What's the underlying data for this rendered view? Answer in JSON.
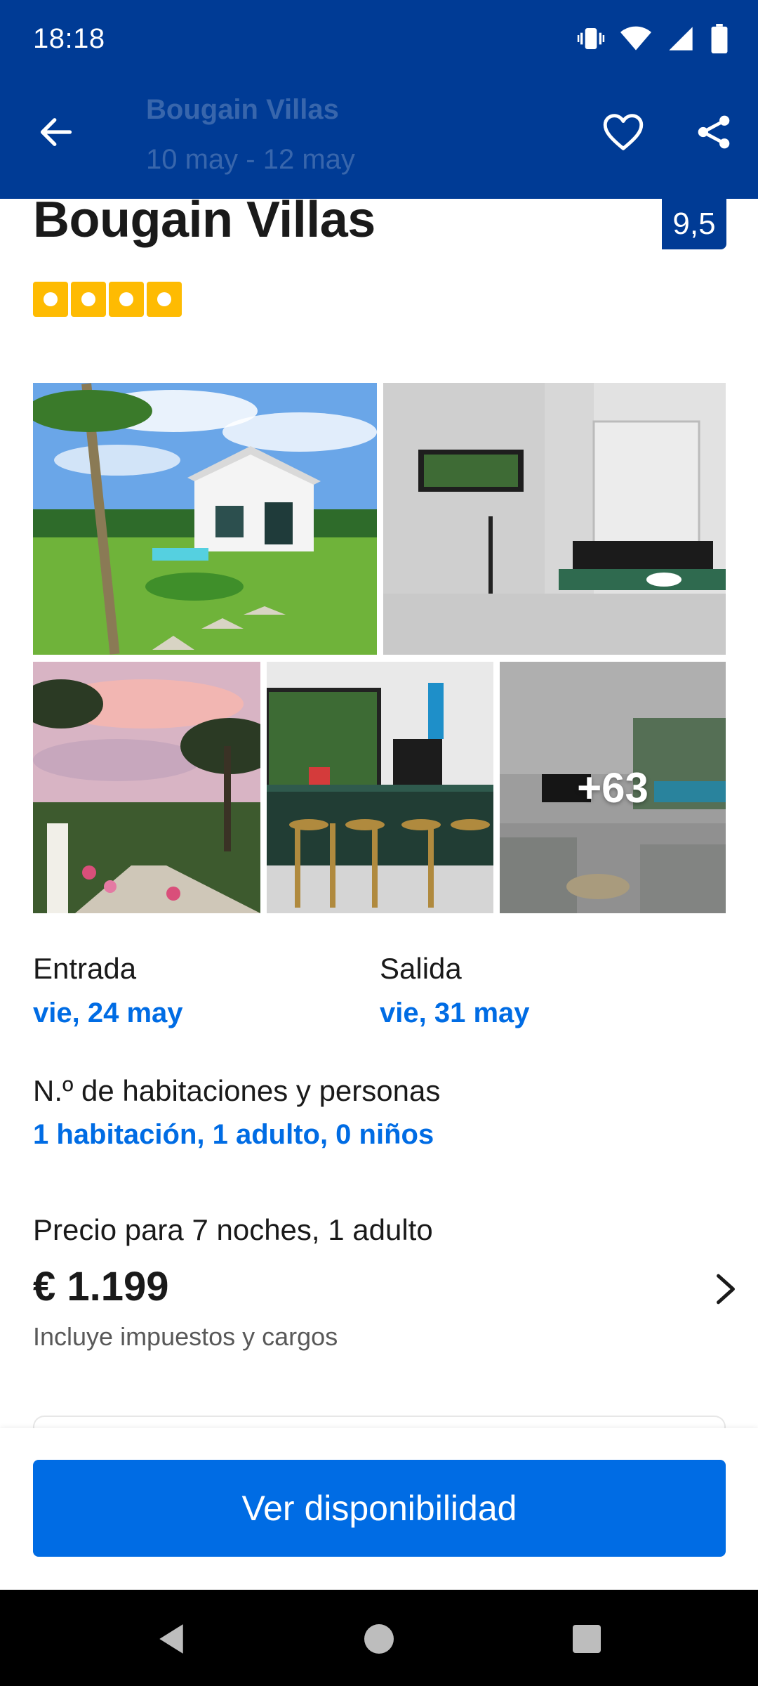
{
  "status_bar": {
    "time": "18:18",
    "icons": [
      "vibrate-icon",
      "wifi-icon",
      "signal-icon",
      "battery-icon"
    ]
  },
  "toolbar": {
    "title": "Bougain Villas",
    "subtitle": "10 may - 12 may",
    "icons": [
      "back-arrow-icon",
      "heart-icon",
      "share-icon"
    ]
  },
  "property": {
    "name": "Bougain Villas",
    "score": "9,5",
    "stars": 4
  },
  "gallery": {
    "more_photos": "+63",
    "photos": [
      "villa-exterior",
      "bathroom",
      "garden-sunset",
      "kitchen-bar",
      "living-room"
    ]
  },
  "dates": {
    "checkin_label": "Entrada",
    "checkin_value": "vie, 24 may",
    "checkout_label": "Salida",
    "checkout_value": "vie, 31 may"
  },
  "guests": {
    "label": "N.º de habitaciones y personas",
    "value": "1 habitación, 1 adulto, 0 niños"
  },
  "price": {
    "label": "Precio para 7 noches, 1 adulto",
    "value": "€ 1.199",
    "note": "Incluye impuestos y cargos"
  },
  "cta": {
    "label": "Ver disponibilidad"
  },
  "colors": {
    "header_blue": "#003b95",
    "action_blue": "#006ce4",
    "star_yellow": "#febb02"
  }
}
